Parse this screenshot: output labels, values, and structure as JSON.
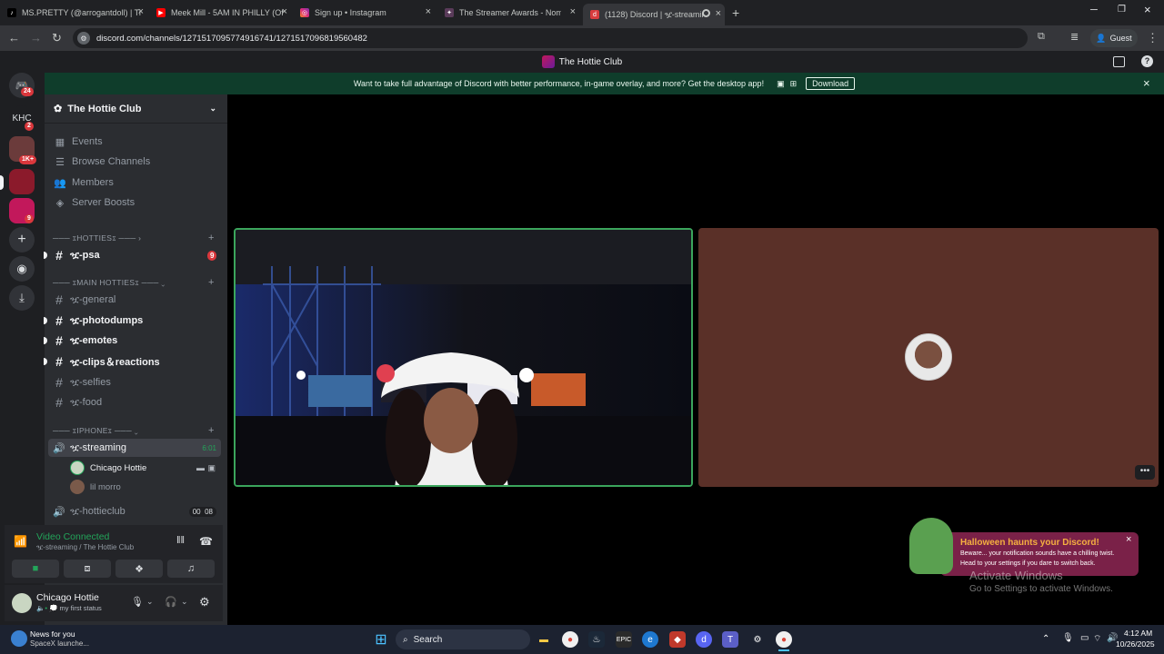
{
  "browser": {
    "tabs": [
      {
        "title": "MS.PRETTY (@arrogantdoll) | Ti",
        "icon": "tiktok-icon"
      },
      {
        "title": "Meek Mill - 5AM IN PHILLY (Of",
        "icon": "youtube-icon"
      },
      {
        "title": "Sign up • Instagram",
        "icon": "instagram-icon"
      },
      {
        "title": "The Streamer Awards - Nomina",
        "icon": "streamer-awards-icon"
      },
      {
        "title": "(1128) Discord | ዧ-streamin",
        "icon": "discord-icon"
      }
    ],
    "url": "discord.com/channels/1271517095774916741/1271517096819560482",
    "profile": "Guest"
  },
  "discord": {
    "window_title": "The Hottie Club",
    "banner": {
      "text": "Want to take full advantage of Discord with better performance, in-game overlay, and more? Get the desktop app!",
      "button": "Download"
    },
    "servers": {
      "dm_badge": "24",
      "khc_label": "KHC",
      "khc_badge": "2",
      "s2_badge": "1K+",
      "s4_badge": "9"
    },
    "server_name": "The Hottie Club",
    "menu": [
      "Events",
      "Browse Channels",
      "Members",
      "Server Boosts"
    ],
    "categories": [
      "ೱHOTTIESೱ",
      "ೱMAIN HOTTIESೱ",
      "ೱIPHONEೱ"
    ],
    "channels": {
      "psa": "ዧ-psa",
      "psa_badge": "9",
      "general": "ዧ-general",
      "photodumps": "ዧ-photodumps",
      "emotes": "ዧ-emotes",
      "clips": "ዧ-clips＆reactions",
      "selfies": "ዧ-selfies",
      "food": "ዧ-food",
      "streaming": "ዧ-streaming",
      "streaming_time": "6:01",
      "hottieclub": "ዧ-hottieclub",
      "hottieclub_count_a": "00",
      "hottieclub_count_b": "08"
    },
    "voice_users": [
      "Chicago Hottie",
      "lil morro"
    ],
    "voice_status": {
      "title": "Video Connected",
      "subtitle": "ዧ-streaming / The Hottie Club"
    },
    "user": {
      "name": "Chicago Hottie",
      "status": "my first status"
    },
    "toast": {
      "title": "Halloween haunts your Discord!",
      "line1": "Beware... your notification sounds have a chilling twist.",
      "line2": "Head to your settings if you dare to switch back."
    }
  },
  "windows": {
    "activate_title": "Activate Windows",
    "activate_sub": "Go to Settings to activate Windows."
  },
  "taskbar": {
    "news_title": "News for you",
    "news_sub": "SpaceX launche...",
    "search": "Search",
    "time": "4:12 AM",
    "date": "10/26/2025"
  }
}
